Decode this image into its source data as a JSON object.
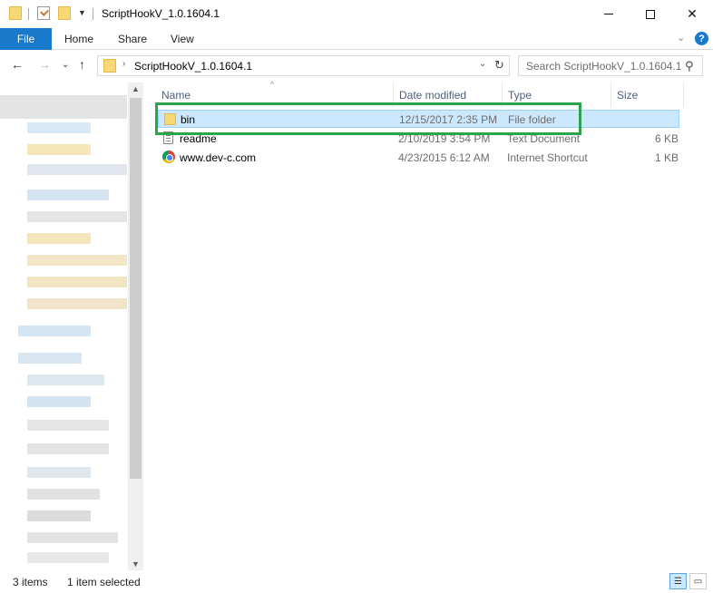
{
  "window": {
    "title": "ScriptHookV_1.0.1604.1",
    "minimize_glyph": "",
    "maximize_glyph": "",
    "close_glyph": "✕"
  },
  "ribbon": {
    "tabs": [
      {
        "label": "File",
        "active": true
      },
      {
        "label": "Home"
      },
      {
        "label": "Share"
      },
      {
        "label": "View"
      }
    ],
    "help_glyph": "?",
    "accent_color": "#1979ca"
  },
  "address": {
    "path": "ScriptHookV_1.0.1604.1",
    "search_placeholder": "Search ScriptHookV_1.0.1604.1"
  },
  "columns": [
    "Name",
    "Date modified",
    "Type",
    "Size"
  ],
  "files": [
    {
      "name": "bin",
      "date": "12/15/2017 2:35 PM",
      "type": "File folder",
      "size": "",
      "icon": "folder-icon",
      "selected": true
    },
    {
      "name": "readme",
      "date": "2/10/2019 3:54 PM",
      "type": "Text Document",
      "size": "6 KB",
      "icon": "text-document-icon",
      "selected": false
    },
    {
      "name": "www.dev-c.com",
      "date": "4/23/2015 6:12 AM",
      "type": "Internet Shortcut",
      "size": "1 KB",
      "icon": "internet-shortcut-icon",
      "selected": false
    }
  ],
  "status": {
    "item_count": "3 items",
    "selection": "1 item selected"
  },
  "colors": {
    "selection_bg": "#cce8ff",
    "highlight_border": "#2ca54a"
  }
}
